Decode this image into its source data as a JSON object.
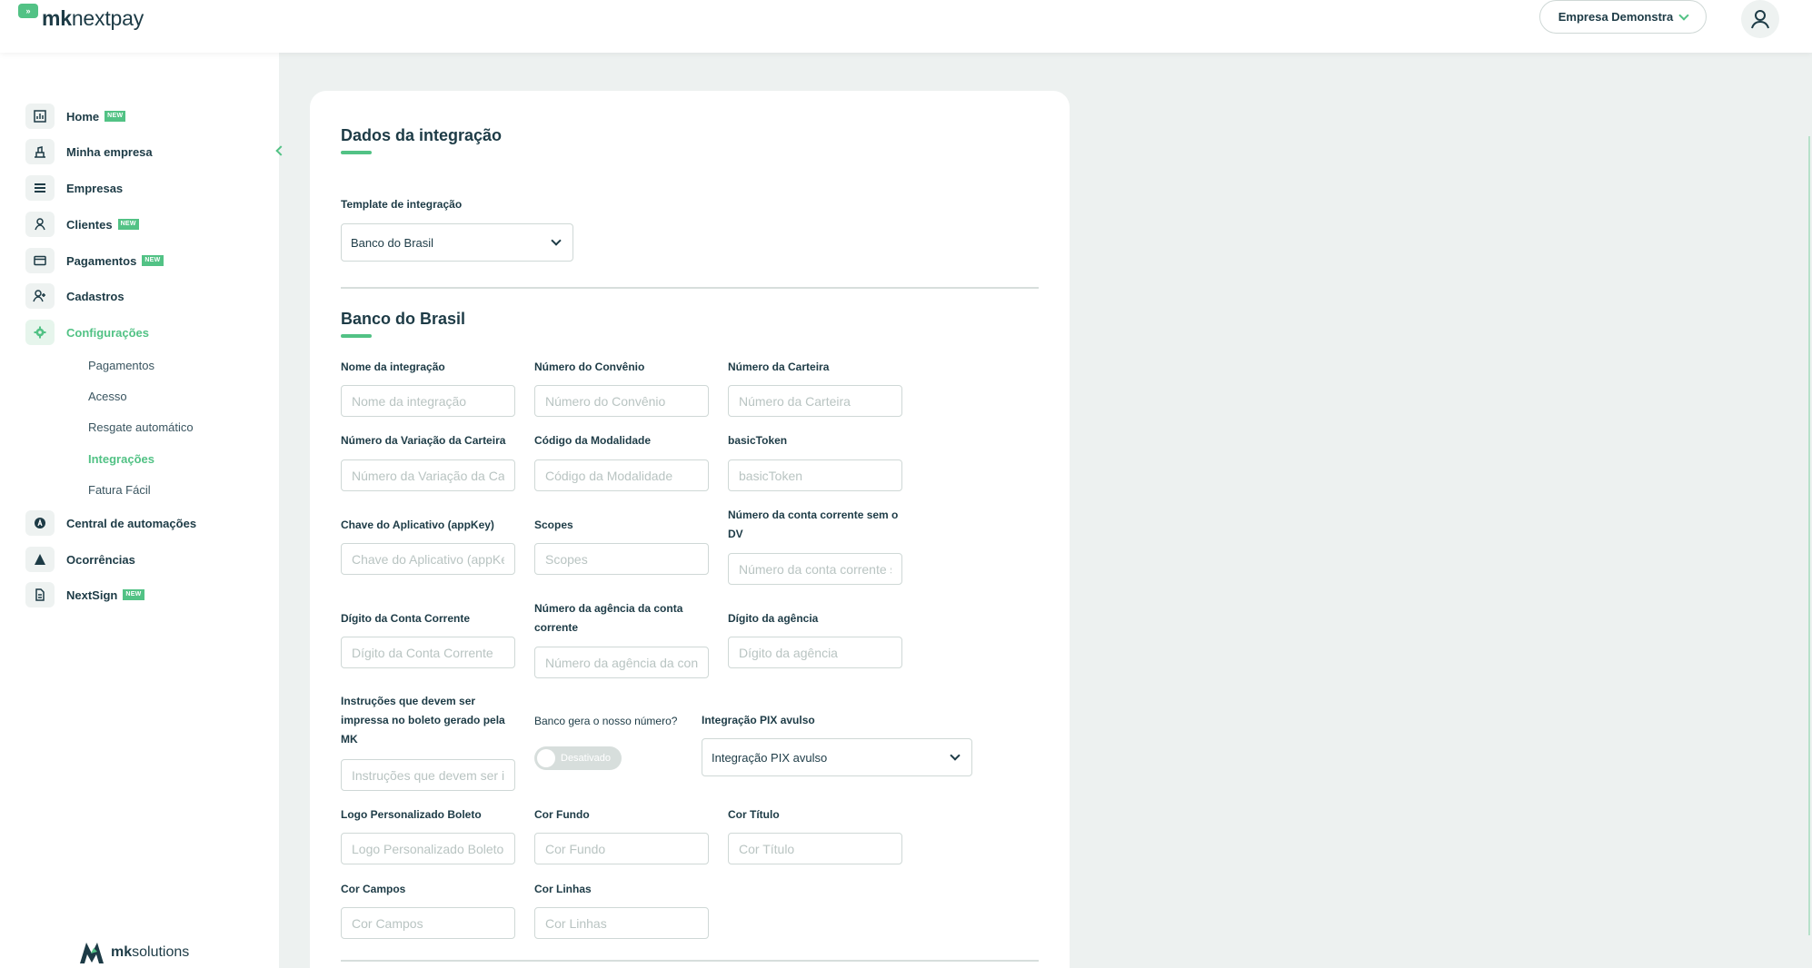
{
  "header": {
    "logo_bold": "mk",
    "logo_rest": "nextpay",
    "logo_badge": "»",
    "company_label": "Empresa Demonstra"
  },
  "sidebar": {
    "items": [
      {
        "label": "Home",
        "badge": "NEW",
        "icon": "dashboard-icon"
      },
      {
        "label": "Minha empresa",
        "badge": "",
        "icon": "building-icon"
      },
      {
        "label": "Empresas",
        "badge": "",
        "icon": "list-icon"
      },
      {
        "label": "Clientes",
        "badge": "NEW",
        "icon": "person-icon"
      },
      {
        "label": "Pagamentos",
        "badge": "NEW",
        "icon": "credit-card-icon"
      },
      {
        "label": "Cadastros",
        "badge": "",
        "icon": "add-user-icon"
      },
      {
        "label": "Configurações",
        "badge": "",
        "icon": "gear-icon"
      },
      {
        "label": "Central de automações",
        "badge": "",
        "icon": "automation-icon"
      },
      {
        "label": "Ocorrências",
        "badge": "",
        "icon": "warning-icon"
      },
      {
        "label": "NextSign",
        "badge": "NEW",
        "icon": "document-icon"
      }
    ],
    "sub_items": [
      "Pagamentos",
      "Acesso",
      "Resgate automático",
      "Integrações",
      "Fatura Fácil"
    ],
    "footer_bold": "mk",
    "footer_rest": "solutions"
  },
  "main": {
    "section1_title": "Dados da integração",
    "template_label": "Template de integração",
    "template_value": "Banco do Brasil",
    "section2_title": "Banco do Brasil",
    "fields": {
      "nome": {
        "label": "Nome da integração",
        "placeholder": "Nome da integração"
      },
      "convenio": {
        "label": "Número do Convênio",
        "placeholder": "Número do Convênio"
      },
      "carteira": {
        "label": "Número da Carteira",
        "placeholder": "Número da Carteira"
      },
      "variacao": {
        "label": "Número da Variação da Carteira",
        "placeholder": "Número da Variação da Carteira"
      },
      "modalidade": {
        "label": "Código da Modalidade",
        "placeholder": "Código da Modalidade"
      },
      "basic_token": {
        "label": "basicToken",
        "placeholder": "basicToken"
      },
      "app_key": {
        "label": "Chave do Aplicativo (appKey)",
        "placeholder": "Chave do Aplicativo (appKey)"
      },
      "scopes": {
        "label": "Scopes",
        "placeholder": "Scopes"
      },
      "conta_sem_dv": {
        "label": "Número da conta corrente sem o DV",
        "placeholder": "Número da conta corrente sem o DV"
      },
      "digito_conta": {
        "label": "Dígito da Conta Corrente",
        "placeholder": "Dígito da Conta Corrente"
      },
      "agencia": {
        "label": "Número da agência da conta corrente",
        "placeholder": "Número da agência da conta corrente"
      },
      "digito_agencia": {
        "label": "Dígito da agência",
        "placeholder": "Dígito da agência"
      },
      "instrucoes": {
        "label": "Instruções que devem ser impressa no boleto gerado pela MK",
        "placeholder": "Instruções que devem ser impressa no boleto gerado pela MK"
      },
      "banco_gera": {
        "label": "Banco gera o nosso número?",
        "toggle_text": "Desativado"
      },
      "pix_avulso": {
        "label": "Integração PIX avulso",
        "value": "Integração PIX avulso"
      },
      "logo_boleto": {
        "label": "Logo Personalizado Boleto",
        "placeholder": "Logo Personalizado Boleto"
      },
      "cor_fundo": {
        "label": "Cor Fundo",
        "placeholder": "Cor Fundo"
      },
      "cor_titulo": {
        "label": "Cor Título",
        "placeholder": "Cor Título"
      },
      "cor_campos": {
        "label": "Cor Campos",
        "placeholder": "Cor Campos"
      },
      "cor_linhas": {
        "label": "Cor Linhas",
        "placeholder": "Cor Linhas"
      }
    }
  },
  "colors": {
    "accent": "#52c285",
    "text": "#1d3b46",
    "background": "#edf1f0"
  }
}
